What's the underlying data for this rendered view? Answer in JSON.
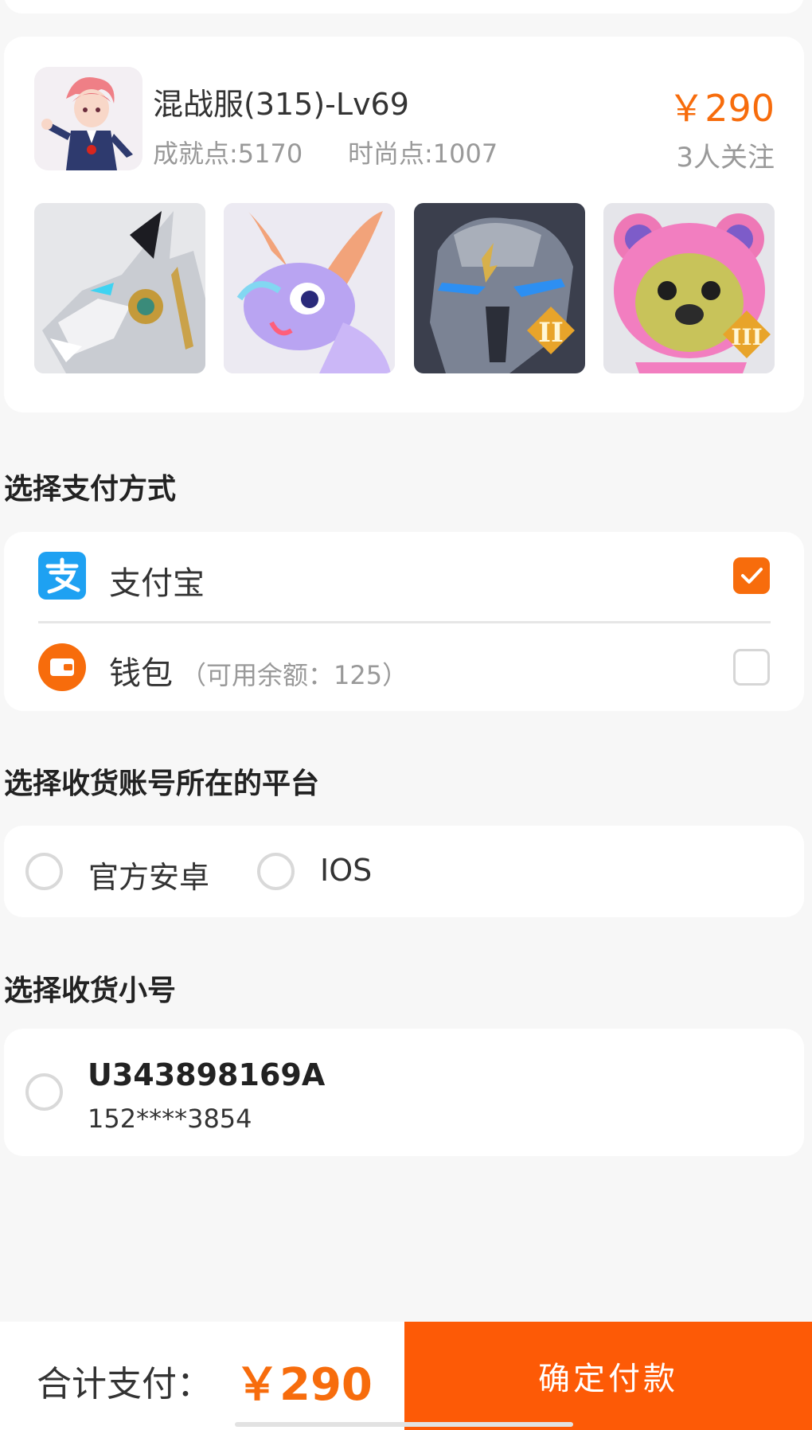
{
  "product": {
    "title": "混战服(315)-Lv69",
    "achievement": "成就点:5170",
    "fashion": "时尚点:1007",
    "price": "￥290",
    "followers": "3人关注",
    "avatar_icon": "character-avatar",
    "thumbnails": [
      {
        "icon": "silver-mecha-dragon-image"
      },
      {
        "icon": "purple-fairy-dragon-image"
      },
      {
        "icon": "stone-golem-image",
        "badge": "II"
      },
      {
        "icon": "pink-bear-image",
        "badge": "III"
      }
    ]
  },
  "payment": {
    "section_title": "选择支付方式",
    "alipay": {
      "label": "支付宝",
      "icon": "alipay-icon",
      "checked": true
    },
    "wallet": {
      "label": "钱包",
      "note": "（可用余额：125）",
      "icon": "wallet-icon",
      "checked": false
    },
    "accent_color": "#f76c0c"
  },
  "platform": {
    "section_title": "选择收货账号所在的平台",
    "options": [
      "官方安卓",
      "IOS"
    ]
  },
  "account": {
    "section_title": "选择收货小号",
    "name": "U343898169A",
    "phone": "152****3854"
  },
  "footer": {
    "total_label": "合计支付：",
    "total_value": "￥290",
    "confirm_label": "确定付款",
    "button_color": "#fd5a06"
  }
}
